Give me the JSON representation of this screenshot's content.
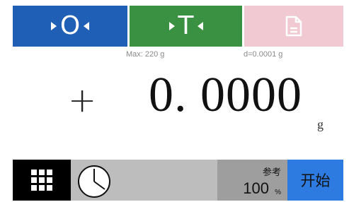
{
  "top_bar": {
    "zero_button": {
      "label": "O"
    },
    "tare_button": {
      "label": "T"
    },
    "print_button": {
      "icon": "document-icon",
      "state": "disabled"
    }
  },
  "balance_info": {
    "max_capacity": "Max: 220 g",
    "readability": "d=0.0001 g"
  },
  "display": {
    "sign": "+",
    "weight": "0. 0000",
    "unit": "g"
  },
  "bottom_bar": {
    "menu_icon": "grid-menu-icon",
    "timer_icon": "clock-icon",
    "reference": {
      "label": "参考",
      "value": "100",
      "unit": "%"
    },
    "start_button": {
      "label": "开始"
    }
  },
  "colors": {
    "zero": "#1f5fb5",
    "tare": "#3a9142",
    "print_disabled": "#f1c9d2",
    "timer_bg": "#bdbdbd",
    "reference_bg": "#9e9e9e",
    "start": "#2d7be0"
  }
}
